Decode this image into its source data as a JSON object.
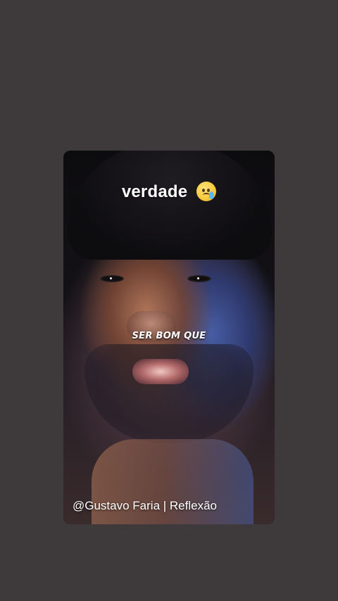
{
  "story": {
    "caption_top": "verdade",
    "caption_emoji": "crying-face-with-tear",
    "subtitle": "SER BOM QUE",
    "credit": "@Gustavo Faria | Reflexão"
  },
  "colors": {
    "page_background": "#3e393b",
    "text": "#ffffff"
  }
}
